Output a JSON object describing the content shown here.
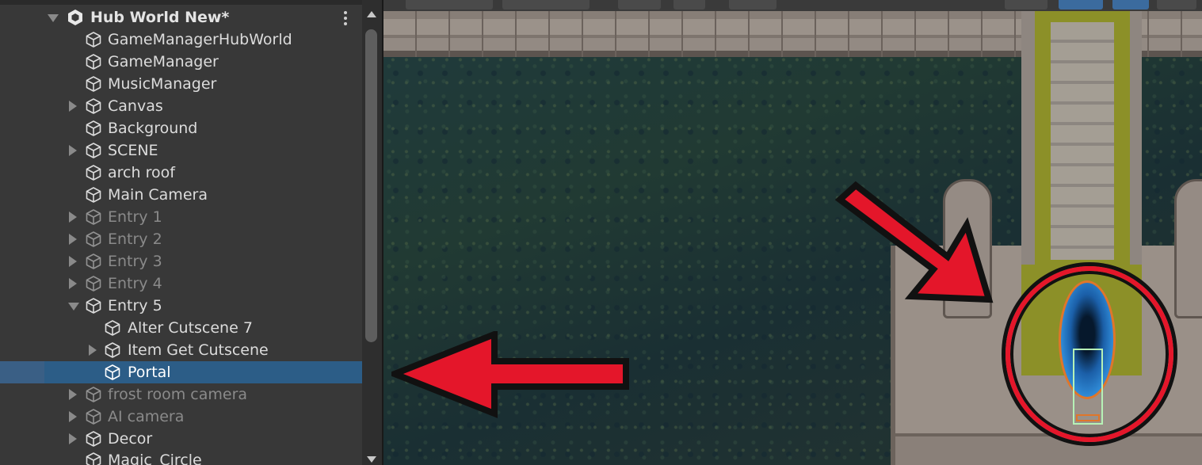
{
  "hierarchy": {
    "scene_name": "Hub World New*",
    "items": [
      {
        "label": "GameManagerHubWorld"
      },
      {
        "label": "GameManager"
      },
      {
        "label": "MusicManager"
      },
      {
        "label": "Canvas"
      },
      {
        "label": "Background"
      },
      {
        "label": "SCENE"
      },
      {
        "label": "arch roof"
      },
      {
        "label": "Main Camera"
      },
      {
        "label": "Entry 1"
      },
      {
        "label": "Entry 2"
      },
      {
        "label": "Entry 3"
      },
      {
        "label": "Entry 4"
      },
      {
        "label": "Entry 5"
      },
      {
        "label": "Alter Cutscene 7"
      },
      {
        "label": "Item Get Cutscene"
      },
      {
        "label": "Portal"
      },
      {
        "label": "frost room camera"
      },
      {
        "label": "AI camera"
      },
      {
        "label": "Decor"
      },
      {
        "label": "Magic_Circle"
      }
    ]
  },
  "colors": {
    "selection": "#2c5d87",
    "annotation_red": "#e4162a",
    "panel_bg": "#383838"
  },
  "icons": {
    "scene": "unity-scene-icon",
    "object": "gameobject-cube-icon",
    "menu": "kebab-menu-icon"
  }
}
